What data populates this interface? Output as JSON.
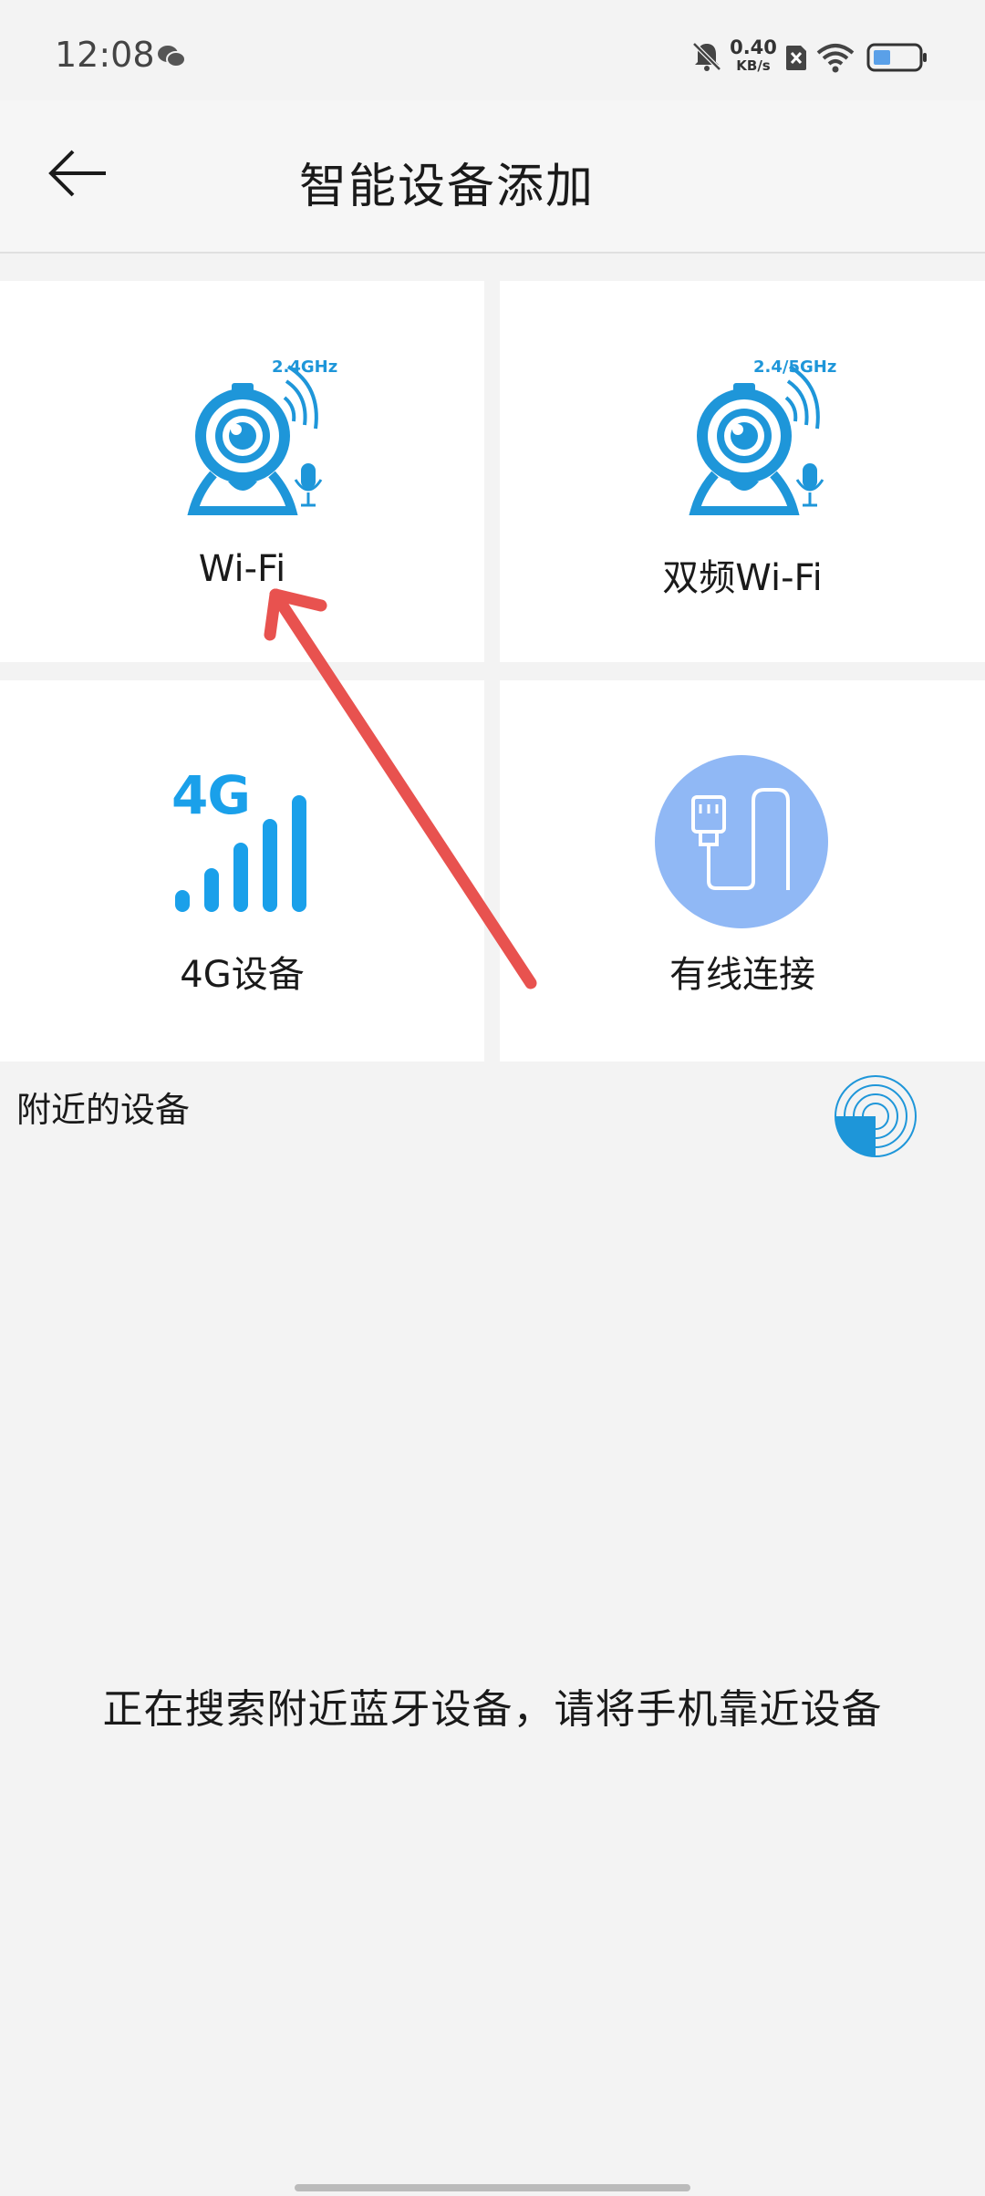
{
  "status_bar": {
    "time": "12:08",
    "net_speed_value": "0.40",
    "net_speed_unit": "KB/s",
    "icons": [
      "wechat-icon",
      "mute-bell-icon",
      "sim-off-icon",
      "wifi-icon",
      "battery-icon"
    ]
  },
  "header": {
    "title": "智能设备添加",
    "back_icon": "arrow-left-icon"
  },
  "tiles": [
    {
      "label": "Wi-Fi",
      "badge": "2.4GHz",
      "icon": "webcam-wifi-icon"
    },
    {
      "label": "双频Wi-Fi",
      "badge": "2.4/5GHz",
      "icon": "webcam-wifi-icon"
    },
    {
      "label": "4G设备",
      "badge": "4G",
      "icon": "signal-4g-icon"
    },
    {
      "label": "有线连接",
      "icon": "ethernet-cable-icon"
    }
  ],
  "nearby": {
    "label": "附近的设备",
    "spinner_icon": "radar-scan-icon"
  },
  "search_message": "正在搜索附近蓝牙设备，请将手机靠近设备",
  "colors": {
    "accent_blue": "#1e96d9",
    "signal_blue": "#1aa0ea",
    "wired_circle": "#90b8f5",
    "annotation_red": "#e8524f",
    "background": "#f3f3f3"
  }
}
